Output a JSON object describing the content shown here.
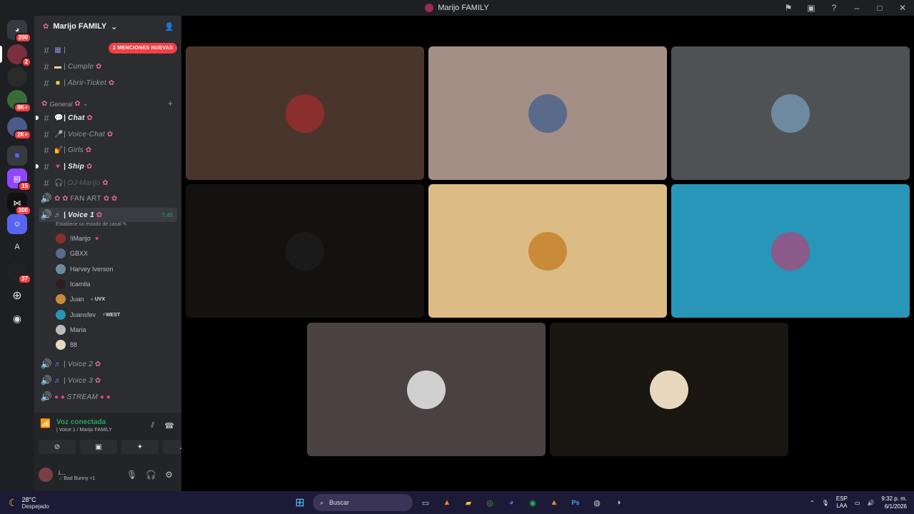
{
  "window": {
    "title": "Marijo FAMILY"
  },
  "server": {
    "name": "Marijo FAMILY"
  },
  "servers": [
    {
      "icon": "discord-home-icon",
      "badge": "200"
    },
    {
      "icon": "server-avatar-icon",
      "badge": "2"
    },
    {
      "icon": "server-avatar-icon",
      "badge": ""
    },
    {
      "icon": "server-avatar-icon",
      "badge": "8K+"
    },
    {
      "icon": "server-avatar-icon",
      "badge": "2K+"
    },
    {
      "icon": "folder-icon",
      "badge": ""
    },
    {
      "icon": "twitch-icon",
      "badge": "15"
    },
    {
      "icon": "server-avatar-icon",
      "badge": "300"
    },
    {
      "icon": "server-avatar-icon",
      "badge": ""
    },
    {
      "icon": "letter-a-icon",
      "label": "A",
      "badge": ""
    },
    {
      "icon": "server-avatar-icon",
      "badge": "37"
    },
    {
      "icon": "add-server-icon",
      "badge": ""
    },
    {
      "icon": "explore-icon",
      "badge": ""
    }
  ],
  "mentions_pill": "2 MENCIONES NUEVAS",
  "channels_top": [
    {
      "name": "| Cumple",
      "icon": "cake-emoji"
    },
    {
      "name": "| Abrir-Ticket",
      "icon": "ticket-emoji"
    }
  ],
  "category": {
    "name": "General"
  },
  "channels": [
    {
      "name": "| Chat",
      "type": "text",
      "bold": true
    },
    {
      "name": "| Voice-Chat",
      "type": "text",
      "bold": false
    },
    {
      "name": "| Girls",
      "type": "text",
      "bold": false
    },
    {
      "name": "| Ship",
      "type": "text",
      "bold": true
    },
    {
      "name": "| DJ-Marijo",
      "type": "text",
      "bold": false,
      "muted": true
    },
    {
      "name": "FAN ART",
      "type": "voice"
    },
    {
      "name": "| Voice 1",
      "type": "voice",
      "active": true,
      "timer": "7:45",
      "status": "Establece un estado de canal"
    }
  ],
  "voice_members": [
    {
      "name": "!iMarijo",
      "tag": ""
    },
    {
      "name": "GBXX",
      "tag": ""
    },
    {
      "name": "Harvey Iverson",
      "tag": ""
    },
    {
      "name": "Icamila",
      "tag": ""
    },
    {
      "name": "Juan",
      "tag": "UVX"
    },
    {
      "name": "Juansfev",
      "tag": "WEST"
    },
    {
      "name": "Maria",
      "tag": ""
    },
    {
      "name": "88",
      "tag": ""
    }
  ],
  "channels_bottom": [
    {
      "name": "| Voice 2"
    },
    {
      "name": "| Voice 3"
    },
    {
      "name": "STREAM"
    }
  ],
  "voice_panel": {
    "status": "Voz conectada",
    "location": "| Voice 1 / Marijo FAMILY"
  },
  "user": {
    "name": "i...",
    "activity": "Bad Bunny +1"
  },
  "tiles": [
    {
      "bg": "#4a352d",
      "avatar_color": "#8b2e2e"
    },
    {
      "bg": "#a48f86",
      "avatar_color": "#5a6a8a"
    },
    {
      "bg": "#4e5254",
      "avatar_color": "#6d8aa0"
    },
    {
      "bg": "#141210",
      "avatar_color": "#1a1a1a"
    },
    {
      "bg": "#dcbc84",
      "avatar_color": "#c98a3a"
    },
    {
      "bg": "#2796b8",
      "avatar_color": "#8a5a8a"
    },
    {
      "bg": "#4a4242",
      "avatar_color": "#d0d0d0"
    },
    {
      "bg": "#1a1612",
      "avatar_color": "#e8d8c0"
    }
  ],
  "taskbar": {
    "temp": "28°C",
    "weather": "Despejado",
    "search": "Buscar",
    "lang1": "ESP",
    "lang2": "LAA",
    "time": "9:32 p. m.",
    "date": "6/1/2026"
  }
}
